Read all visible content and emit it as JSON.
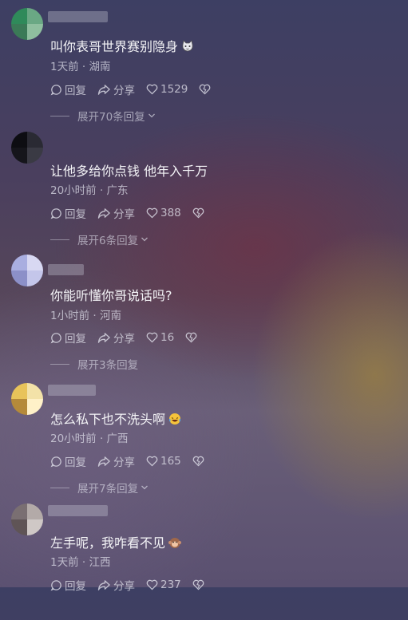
{
  "comments": [
    {
      "text": "叫你表哥世界赛别隐身",
      "emoji": "cat-face-emoji",
      "meta": "1天前 · 湖南",
      "reply_label": "回复",
      "share_label": "分享",
      "like_count": "1529",
      "expand_label": "展开70条回复",
      "avatar_colors": [
        "#2f8a5a",
        "#6aa884",
        "#3b7a57",
        "#8fbf9f"
      ]
    },
    {
      "text": "让他多给你点钱 他年入千万",
      "emoji": "",
      "meta": "20小时前 · 广东",
      "reply_label": "回复",
      "share_label": "分享",
      "like_count": "388",
      "expand_label": "展开6条回复",
      "avatar_colors": [
        "#0d0d12",
        "#2a2a33",
        "#15151b",
        "#3a3a44"
      ]
    },
    {
      "text": "你能听懂你哥说话吗?",
      "emoji": "",
      "meta": "1小时前 · 河南",
      "reply_label": "回复",
      "share_label": "分享",
      "like_count": "16",
      "expand_label": "展开3条回复",
      "avatar_colors": [
        "#a9aee0",
        "#d8d8f2",
        "#8c90c8",
        "#c4c6ea"
      ]
    },
    {
      "text": "怎么私下也不洗头啊",
      "emoji": "laughing-crying-emoji",
      "meta": "20小时前 · 广西",
      "reply_label": "回复",
      "share_label": "分享",
      "like_count": "165",
      "expand_label": "展开7条回复",
      "avatar_colors": [
        "#e8c35a",
        "#f3e2a8",
        "#b58a3a",
        "#fff1c8"
      ]
    },
    {
      "text": "左手呢，我咋看不见",
      "emoji": "monkey-face-emoji",
      "meta": "1天前 · 江西",
      "reply_label": "回复",
      "share_label": "分享",
      "like_count": "237",
      "expand_label": "",
      "avatar_colors": [
        "#7a6f72",
        "#b3aaa8",
        "#5f5456",
        "#cfc8c6"
      ]
    }
  ]
}
